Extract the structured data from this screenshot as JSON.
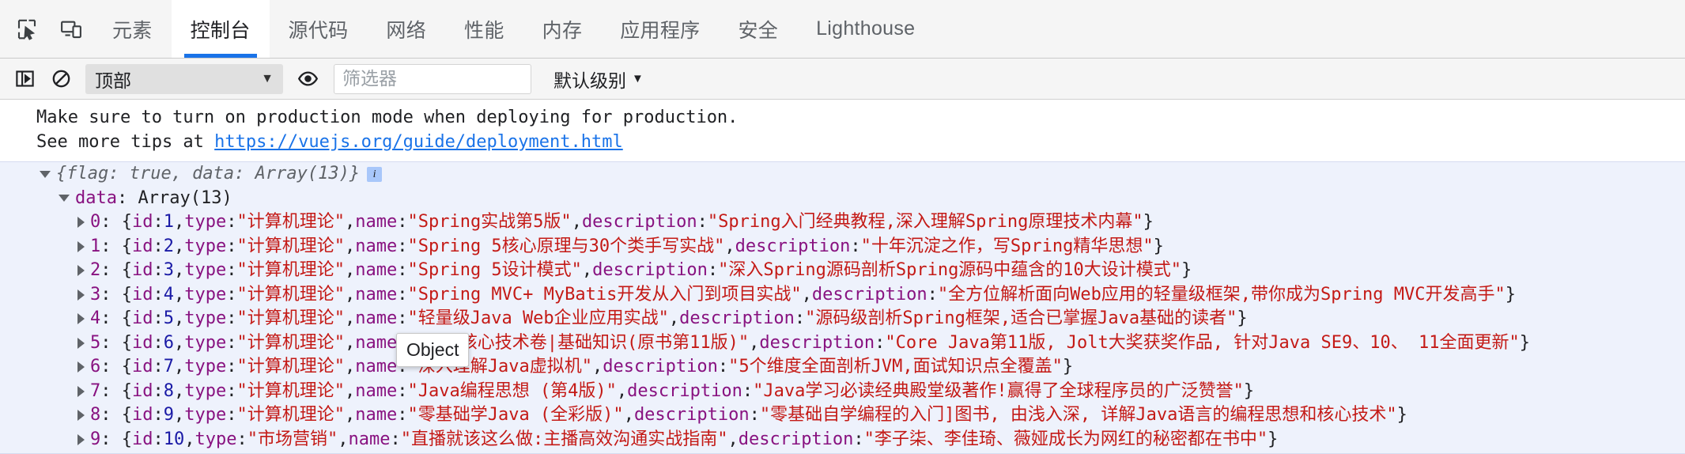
{
  "tabbar": {
    "icons": [
      {
        "name": "inspect-element-icon"
      },
      {
        "name": "device-toolbar-icon"
      }
    ],
    "tabs": [
      {
        "label": "元素",
        "selected": false
      },
      {
        "label": "控制台",
        "selected": true
      },
      {
        "label": "源代码",
        "selected": false
      },
      {
        "label": "网络",
        "selected": false
      },
      {
        "label": "性能",
        "selected": false
      },
      {
        "label": "内存",
        "selected": false
      },
      {
        "label": "应用程序",
        "selected": false
      },
      {
        "label": "安全",
        "selected": false
      },
      {
        "label": "Lighthouse",
        "selected": false
      }
    ]
  },
  "filterbar": {
    "sidebar_toggle_icon": "console-sidebar-icon",
    "clear_icon": "clear-console-icon",
    "context_value": "顶部",
    "context_caret": "▼",
    "eye_icon": "live-expression-eye-icon",
    "filter_placeholder": "筛选器",
    "filter_value": "",
    "level_label": "默认级别",
    "level_caret": "▼"
  },
  "console": {
    "warning_lines": [
      "Make sure to turn on production mode when deploying for production.",
      "See more tips at "
    ],
    "warning_link": "https://vuejs.org/guide/deployment.html",
    "object_preview": "{flag: true, data: Array(13)}",
    "info_badge": "i",
    "data_key": "data",
    "data_value": "Array(13)",
    "tooltip_text": "Object",
    "entries": [
      {
        "index": "0",
        "id": "1",
        "type": "计算机理论",
        "name": "Spring实战第5版",
        "description": "Spring入门经典教程,深入理解Spring原理技术内幕"
      },
      {
        "index": "1",
        "id": "2",
        "type": "计算机理论",
        "name": "Spring 5核心原理与30个类手写实战",
        "description": "十年沉淀之作，写Spring精华思想"
      },
      {
        "index": "2",
        "id": "3",
        "type": "计算机理论",
        "name": "Spring 5设计模式",
        "description": "深入Spring源码剖析Spring源码中蕴含的10大设计模式"
      },
      {
        "index": "3",
        "id": "4",
        "type": "计算机理论",
        "name": "Spring MVC+ MyBatis开发从入门到项目实战",
        "description": "全方位解析面向Web应用的轻量级框架,带你成为Spring MVC开发高手"
      },
      {
        "index": "4",
        "id": "5",
        "type": "计算机理论",
        "name": "轻量级Java Web企业应用实战",
        "description": "源码级剖析Spring框架,适合已掌握Java基础的读者"
      },
      {
        "index": "5",
        "id": "6",
        "type": "计算机理论",
        "name": "Java核心技术卷|基础知识(原书第11版)",
        "description": "Core Java第11版, Jolt大奖获奖作品, 针对Java SE9、10、 11全面更新"
      },
      {
        "index": "6",
        "id": "7",
        "type": "计算机理论",
        "name": "深入理解Java虚拟机",
        "description": "5个维度全面剖析JVM,面试知识点全覆盖"
      },
      {
        "index": "7",
        "id": "8",
        "type": "计算机理论",
        "name": "Java编程思想 (第4版)",
        "description": "Java学习必读经典殿堂级著作!赢得了全球程序员的广泛赞誉"
      },
      {
        "index": "8",
        "id": "9",
        "type": "计算机理论",
        "name": "零基础学Java (全彩版)",
        "description": "零基础自学编程的入门]图书, 由浅入深, 详解Java语言的编程思想和核心技术"
      },
      {
        "index": "9",
        "id": "10",
        "type": "市场营销",
        "name": "直播就该这么做:主播高效沟通实战指南",
        "description": "李子柒、李佳琦、薇娅成长为网红的秘密都在书中"
      }
    ]
  },
  "colors": {
    "accent": "#1a73e8",
    "tab_bg": "#f5f5f5",
    "group_bg": "#eef2fc",
    "string": "#c41a16",
    "property": "#881280",
    "number": "#1a1aa6"
  }
}
